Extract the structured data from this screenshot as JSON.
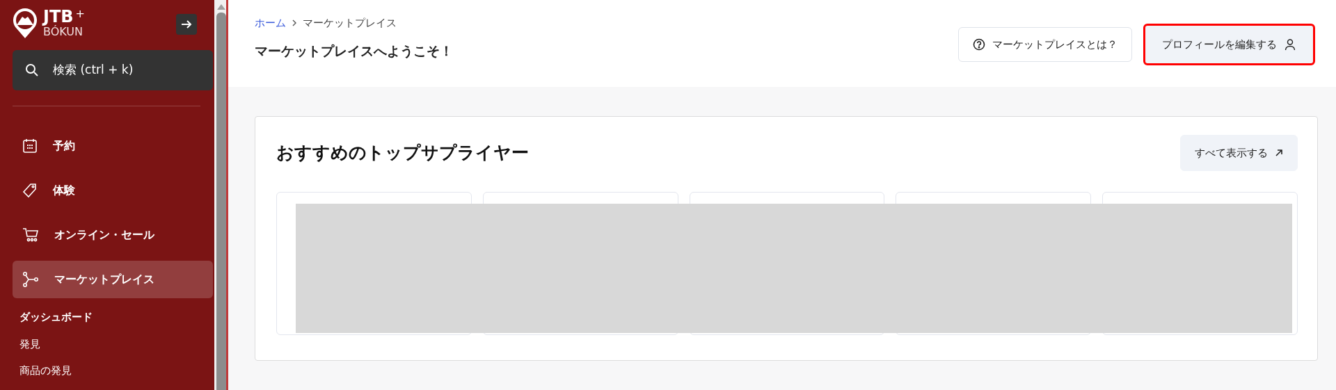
{
  "sidebar": {
    "logo": {
      "brand": "JTB",
      "plus": "+",
      "sub": "BÓKUN"
    },
    "search": {
      "placeholder": "検索 (ctrl + k)"
    },
    "items": [
      {
        "label": "予約",
        "selected": false
      },
      {
        "label": "体験",
        "selected": false
      },
      {
        "label": "オンライン・セール",
        "selected": false
      },
      {
        "label": "マーケットプレイス",
        "selected": true,
        "children": [
          {
            "label": "ダッシュボード",
            "selected": true
          },
          {
            "label": "発見",
            "selected": false
          },
          {
            "label": "商品の発見",
            "selected": false
          }
        ]
      }
    ]
  },
  "breadcrumb": [
    {
      "label": "ホーム",
      "kind": "link"
    },
    {
      "label": "マーケットプレイス",
      "kind": "current"
    }
  ],
  "page_title": "マーケットプレイスへようこそ！",
  "header_buttons": [
    {
      "label": "マーケットプレイスとは？",
      "kind": "outline",
      "highlighted": false
    },
    {
      "label": "プロフィールを編集する",
      "kind": "light",
      "highlighted": true
    }
  ],
  "section": {
    "title": "おすすめのトップサプライヤー",
    "button": "すべて表示する",
    "redacted": true,
    "cards": [
      {
        "kind": "card"
      },
      {
        "kind": "card"
      },
      {
        "kind": "card"
      },
      {
        "kind": "card"
      },
      {
        "kind": "card"
      }
    ]
  }
}
